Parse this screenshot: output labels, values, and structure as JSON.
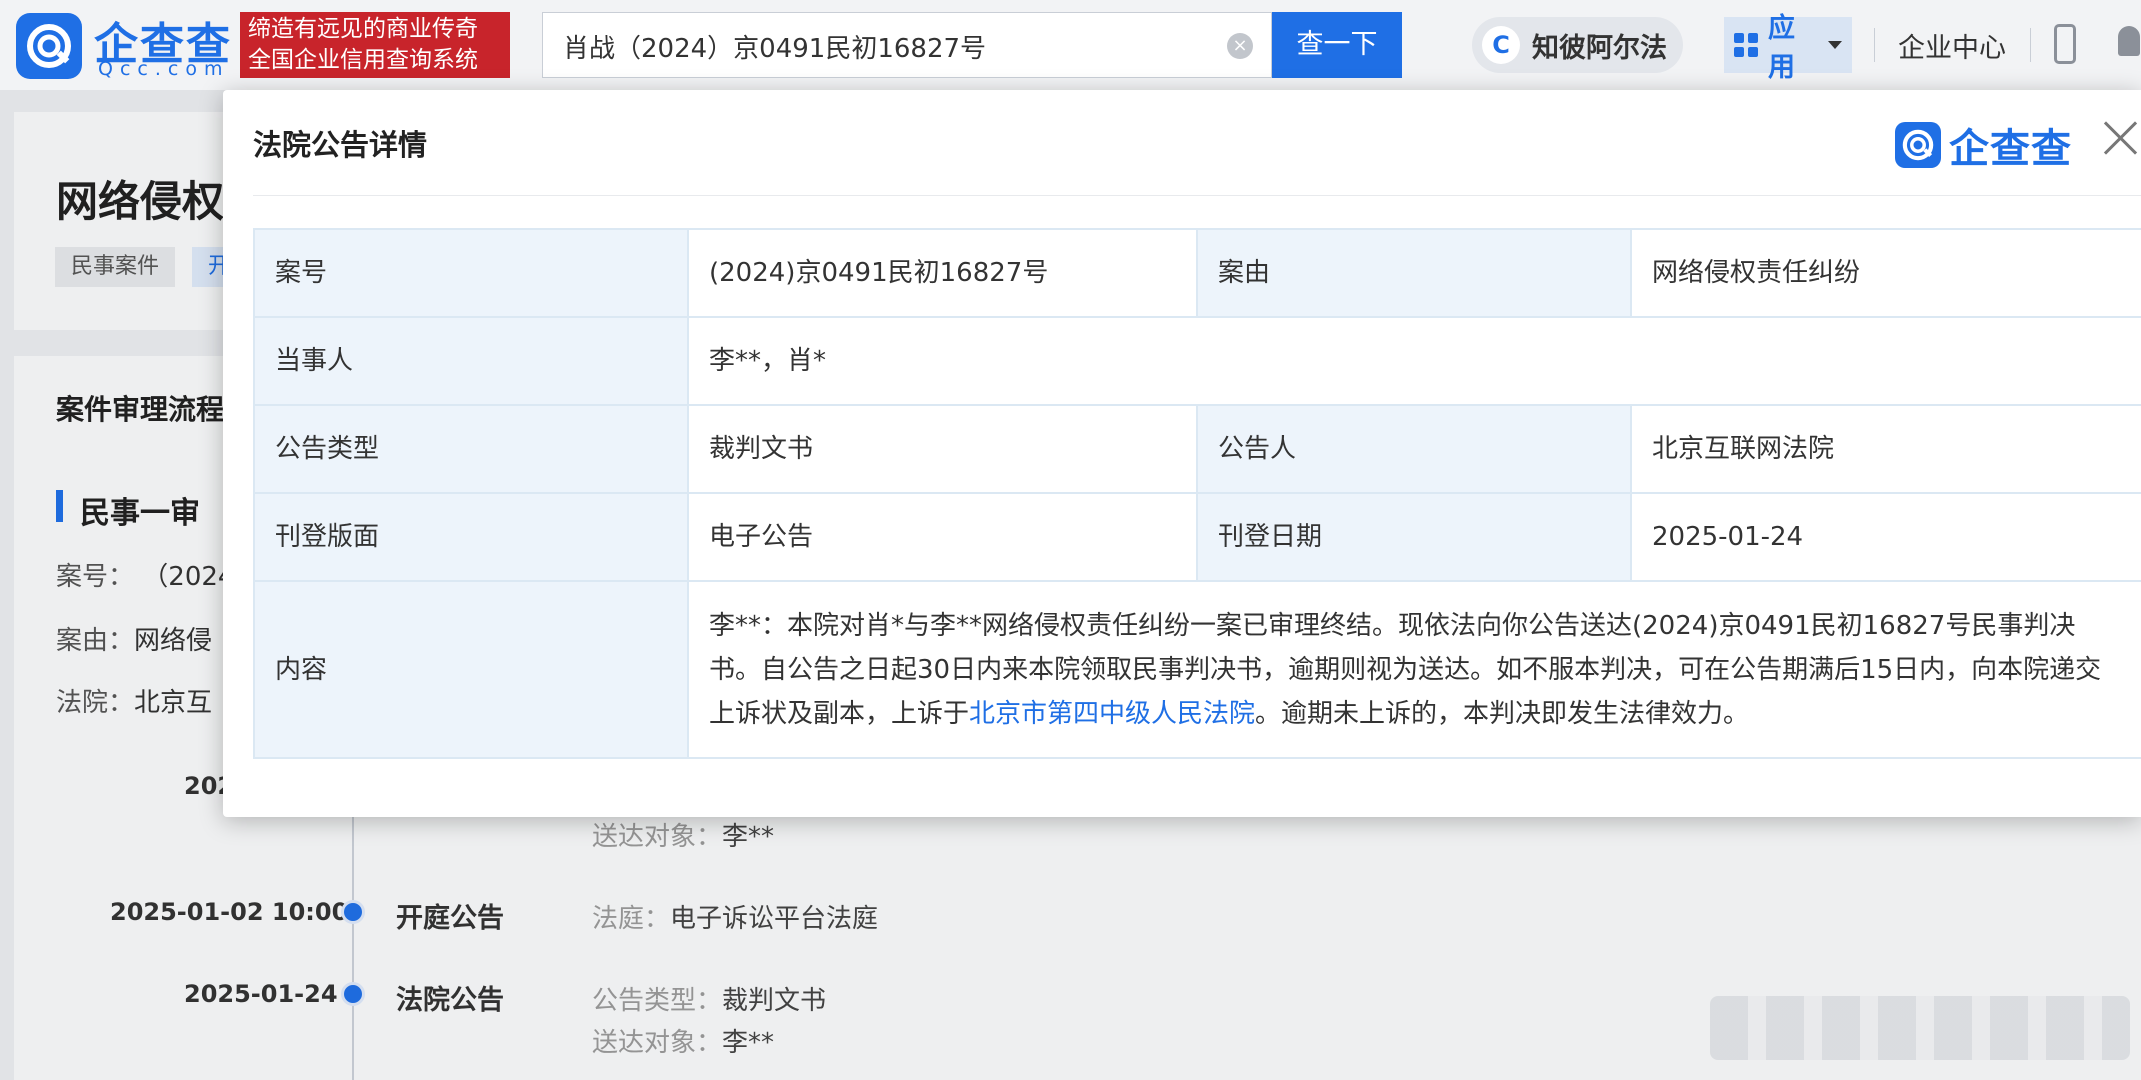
{
  "header": {
    "logo_name": "企查查",
    "logo_domain": "Qcc.com",
    "slogan_line1": "缔造有远见的商业传奇",
    "slogan_line2": "全国企业信用查询系统",
    "search_value": "肖战（2024）京0491民初16827号",
    "search_button": "查一下",
    "zhibi_label": "知彼阿尔法",
    "apps_label": "应用",
    "enterprise_center": "企业中心"
  },
  "page": {
    "case_title": "网络侵权",
    "tag_civil": "民事案件",
    "tag_open": "开",
    "process_title": "案件审理流程",
    "stage_title": "民事一审",
    "case_no_label": "案号：",
    "case_no_value": "（2024",
    "cause_label": "案由：",
    "cause_value": "网络侵",
    "court_label": "法院：",
    "court_value": "北京互",
    "timeline": [
      {
        "date": "202",
        "event": "",
        "details": [
          {
            "label": "送达对象：",
            "value": "李**"
          }
        ]
      },
      {
        "date": "2025-01-02 10:00",
        "event": "开庭公告",
        "details": [
          {
            "label": "法庭：",
            "value": "电子诉讼平台法庭"
          }
        ]
      },
      {
        "date": "2025-01-24",
        "event": "法院公告",
        "details": [
          {
            "label": "公告类型：",
            "value": "裁判文书"
          },
          {
            "label": "送达对象：",
            "value": "李**"
          }
        ]
      }
    ]
  },
  "modal": {
    "title": "法院公告详情",
    "logo_text": "企查查",
    "case_no_label": "案号",
    "case_no_value": "(2024)京0491民初16827号",
    "cause_label": "案由",
    "cause_value": "网络侵权责任纠纷",
    "parties_label": "当事人",
    "parties_value": "李**，肖*",
    "type_label": "公告类型",
    "type_value": "裁判文书",
    "announcer_label": "公告人",
    "announcer_value": "北京互联网法院",
    "layout_label": "刊登版面",
    "layout_value": "电子公告",
    "date_label": "刊登日期",
    "date_value": "2025-01-24",
    "content_label": "内容",
    "content_part1": "李**：本院对肖*与李**网络侵权责任纠纷一案已审理终结。现依法向你公告送达(2024)京0491民初16827号民事判决书。自公告之日起30日内来本院领取民事判决书，逾期则视为送达。如不服本判决，可在公告期满后15日内，向本院递交上诉状及副本，上诉于",
    "content_link": "北京市第四中级人民法院",
    "content_part2": "。逾期未上诉的，本判决即发生法律效力。"
  },
  "colors": {
    "brand_blue": "#1f6fe5",
    "slogan_red": "#c8242b",
    "label_bg": "#edf4fb"
  },
  "icons": [
    "qcc-logo-icon",
    "clear-icon",
    "zhibi-icon",
    "grid-icon",
    "caret-down-icon",
    "phone-icon",
    "bell-icon",
    "close-icon"
  ]
}
